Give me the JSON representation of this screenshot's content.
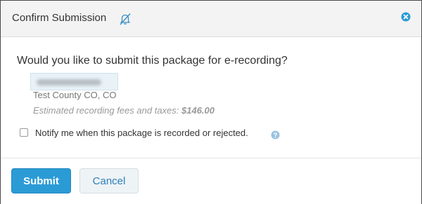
{
  "dialog": {
    "title": "Confirm Submission",
    "title_icon": "bell-off-icon",
    "close_icon": "close-icon"
  },
  "body": {
    "question": "Would you like to submit this package for e-recording?",
    "county": "Test County CO, CO",
    "fees_label": "Estimated recording fees and taxes: ",
    "fees_amount": "$146.00",
    "notify_checked": false,
    "notify_label": "Notify me when this package is recorded or rejected.",
    "help_icon": "help-icon"
  },
  "footer": {
    "submit_label": "Submit",
    "cancel_label": "Cancel"
  },
  "colors": {
    "primary": "#2b9bd6",
    "title_icon": "#3a8fc4",
    "help_icon": "#9ac3e0"
  }
}
